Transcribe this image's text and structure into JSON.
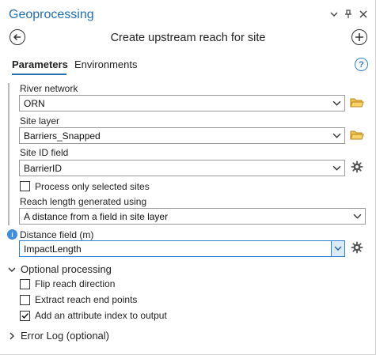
{
  "pane": {
    "title": "Geoprocessing"
  },
  "tool": {
    "title": "Create upstream reach for site"
  },
  "tabs": {
    "parameters": "Parameters",
    "environments": "Environments"
  },
  "params": {
    "river_network": {
      "label": "River network",
      "value": "ORN"
    },
    "site_layer": {
      "label": "Site layer",
      "value": "Barriers_Snapped"
    },
    "site_id_field": {
      "label": "Site ID field",
      "value": "BarrierID"
    },
    "process_selected": {
      "label": "Process only selected sites",
      "checked": false
    },
    "reach_length": {
      "label": "Reach length generated using",
      "value": "A distance from a field in site layer"
    },
    "distance_field": {
      "label": "Distance field (m)",
      "value": "ImpactLength"
    }
  },
  "optional": {
    "title": "Optional processing",
    "flip": {
      "label": "Flip reach direction",
      "checked": false
    },
    "extract": {
      "label": "Extract reach end points",
      "checked": false
    },
    "index": {
      "label": "Add an attribute index to output",
      "checked": true
    }
  },
  "error_log": {
    "title": "Error Log (optional)"
  },
  "colors": {
    "accent": "#1f6fb5",
    "folder": "#e8b836",
    "info": "#3b8ee0"
  }
}
